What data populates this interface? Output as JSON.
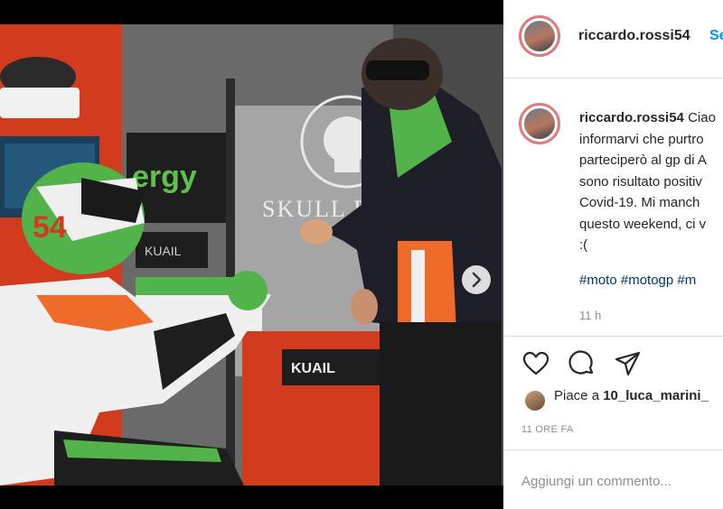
{
  "post": {
    "author": "riccardo.rossi54",
    "follow_label": "Se",
    "caption": "Ciao a tutti, volevo informarvi che purtroppo non parteciperò al gp di Aragon perché sono risultato positivo al test Covid-19. Mi mancherà correre questo weekend, ci vediamo presto :(",
    "caption_lines": [
      "Ciao",
      "informarvi che purtro",
      "parteciperò al gp di A",
      "sono risultato positiv",
      "Covid-19. Mi manch",
      "questo weekend, ci v",
      ":("
    ],
    "hashtags": "#moto #motogp #m",
    "time_ago": "11 h",
    "likes_prefix": "Piace a ",
    "liked_by": "10_luca_marini_",
    "posted": "11 ORE FA",
    "comment_placeholder": "Aggiungi un commento..."
  },
  "photo": {
    "texts": [
      "ergy",
      "SKULL RIDE",
      "KUAIL",
      "KUAIL"
    ],
    "rider_number": "54"
  },
  "icons": [
    "heart-icon",
    "comment-icon",
    "share-icon",
    "chevron-right-icon"
  ],
  "colors": {
    "accent": "#0095f6",
    "hashtag": "#00376b",
    "muted": "#8e8e8e",
    "avatar_ring": "#e07a7a"
  }
}
